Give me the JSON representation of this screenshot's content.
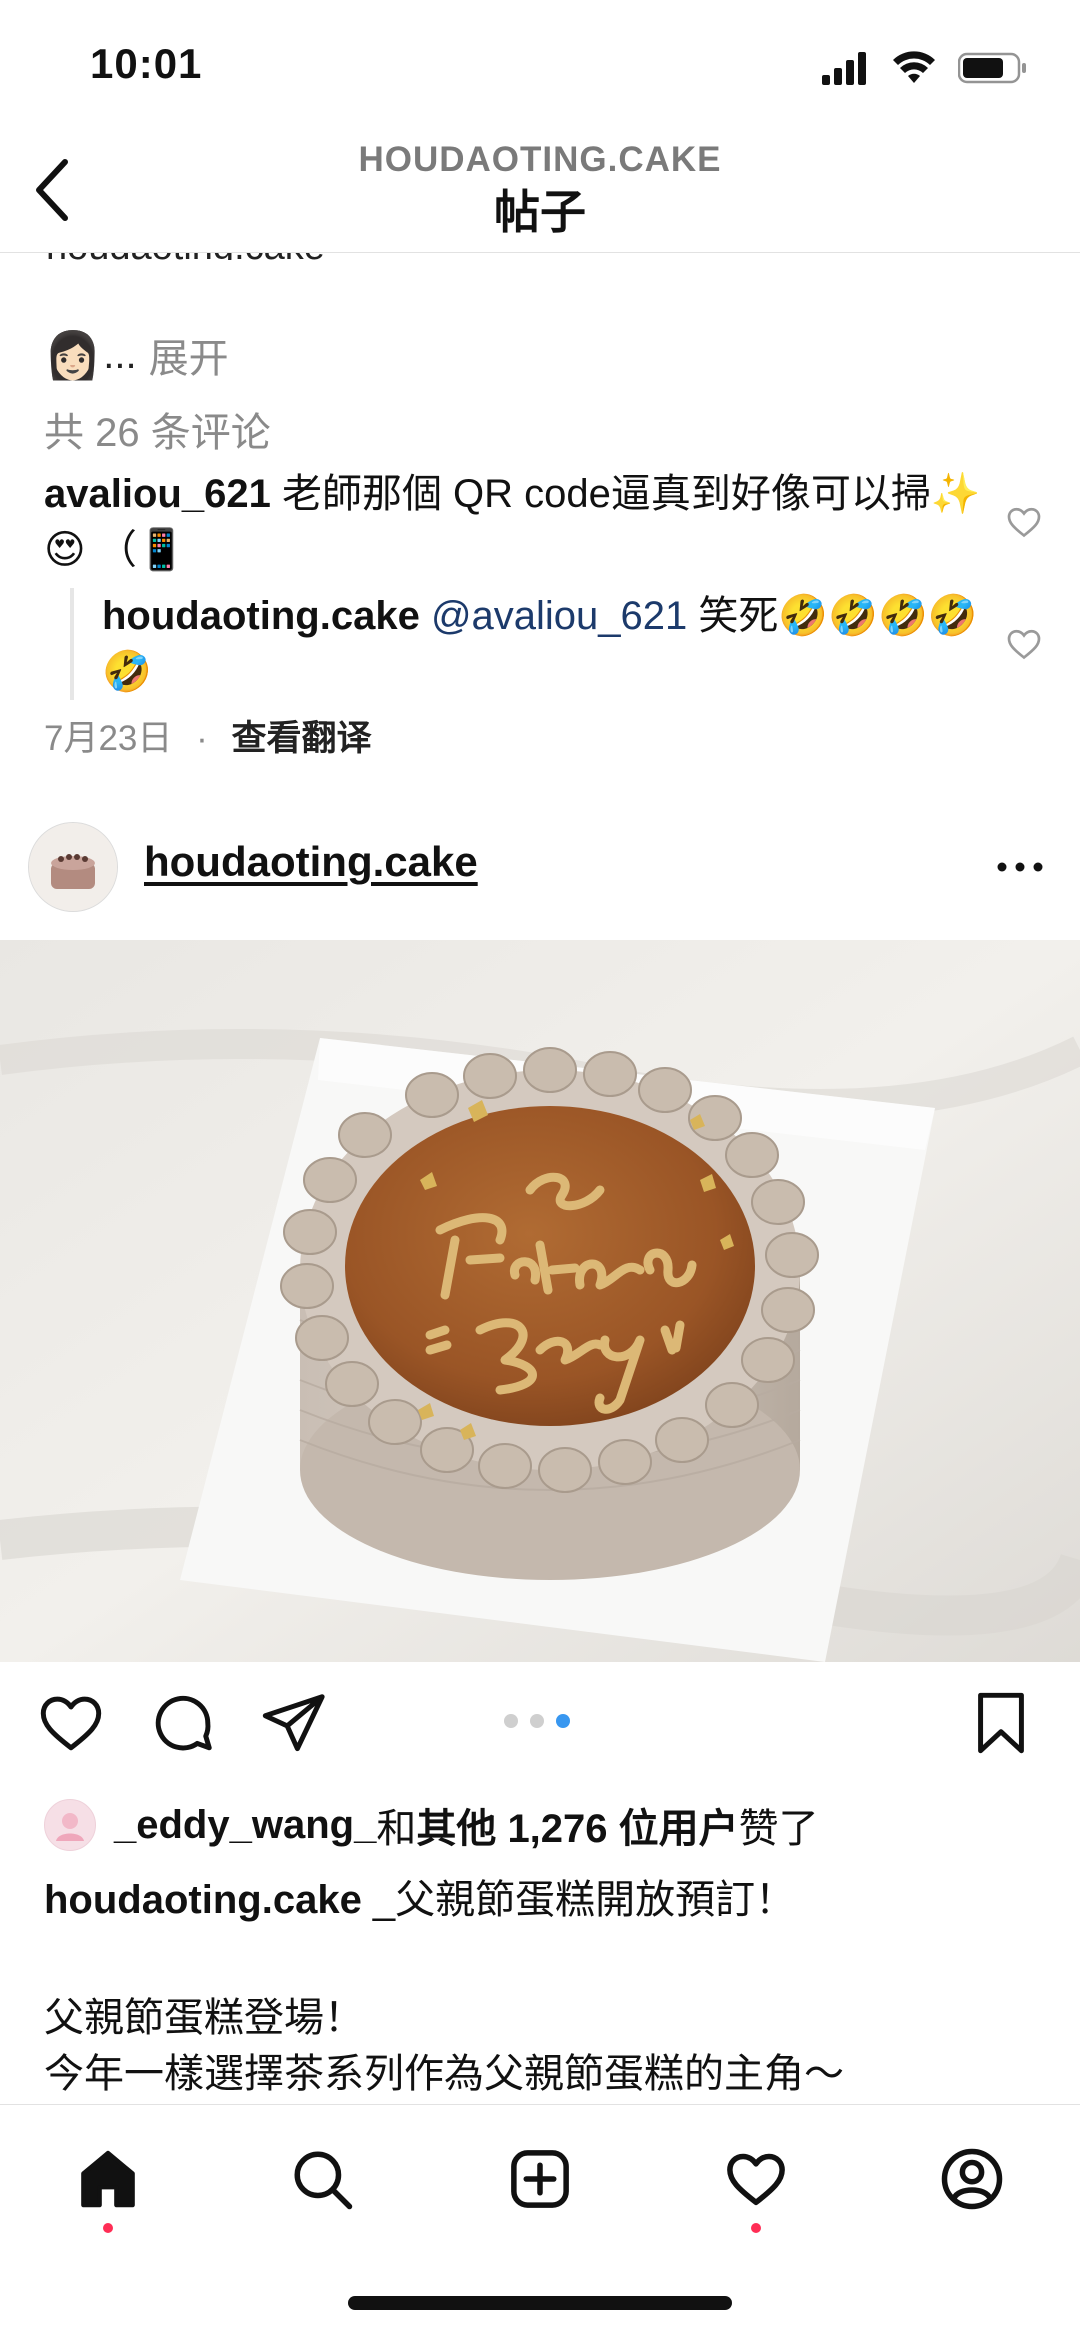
{
  "status_bar": {
    "time": "10:01",
    "icons": [
      "cellular-signal-icon",
      "wifi-icon",
      "battery-icon"
    ]
  },
  "header": {
    "subtitle": "HOUDAOTING.CAKE",
    "title": "帖子"
  },
  "cut_text": "houdaoting.cake _",
  "expand": {
    "emoji": "👩🏻",
    "ellipsis": "...",
    "label": "展开"
  },
  "comments": {
    "count_label": "共 26 条评论",
    "items": [
      {
        "username": "avaliou_621",
        "text": " 老師那個 QR code逼真到好像可以掃✨😍 （📱"
      }
    ],
    "reply": {
      "username": "houdaoting.cake",
      "mention": "@avaliou_621",
      "text": " 笑死🤣🤣🤣🤣🤣"
    },
    "meta": {
      "date": "7月23日",
      "separator": "·",
      "translate_label": "查看翻译"
    }
  },
  "post": {
    "username": "houdaoting.cake",
    "carousel": {
      "total": 3,
      "active_index": 2
    }
  },
  "likes": {
    "first_user": "_eddy_wang_",
    "connector": "和",
    "others": "其他 1,276 位用户",
    "suffix": "赞了"
  },
  "caption": {
    "username": "houdaoting.cake",
    "text": " _父親節蛋糕開放預訂！",
    "line2": "父親節蛋糕登場！",
    "line3": "今年一樣選擇茶系列作為父親節蛋糕的主角～"
  },
  "tabbar": {
    "items": [
      "home-icon",
      "search-icon",
      "create-icon",
      "activity-icon",
      "profile-icon"
    ]
  },
  "colors": {
    "accent_blue": "#3897f0",
    "notify_red": "#ff2d55",
    "mention_blue": "#1c3a6b",
    "cake_caramel": "#9c5c2a"
  }
}
